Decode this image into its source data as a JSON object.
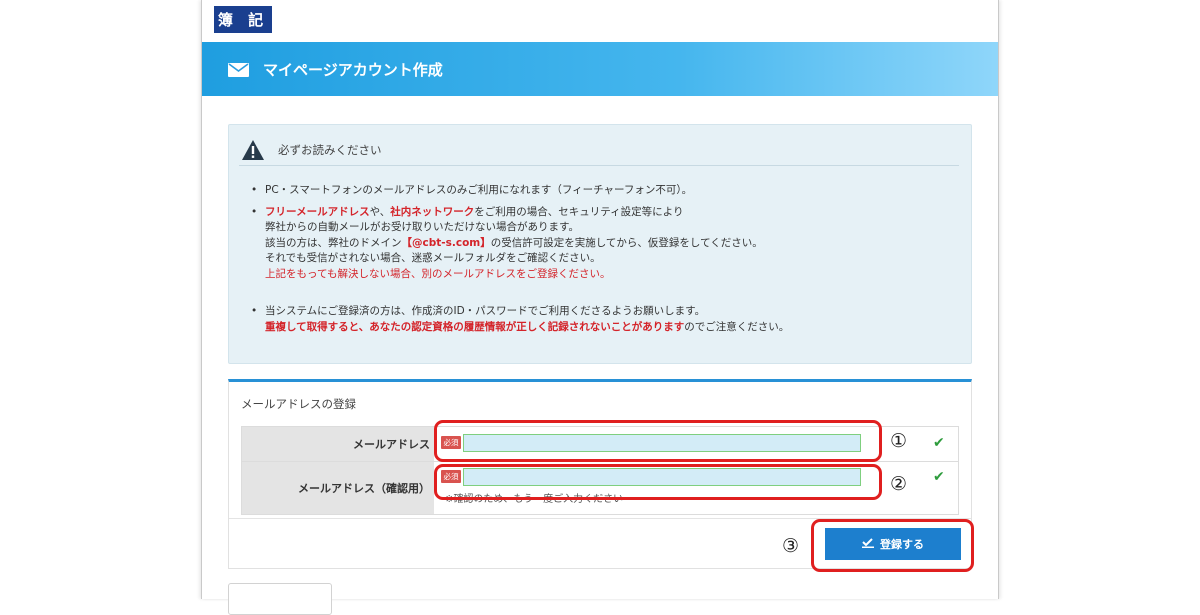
{
  "logo": {
    "text": "簿 記"
  },
  "header": {
    "icon": "mail-icon",
    "title": "マイページアカウント作成"
  },
  "notice": {
    "icon": "warning-icon",
    "heading": "必ずお読みください",
    "b1": "PC・スマートフォンのメールアドレスのみご利用になれます（フィーチャーフォン不可）。",
    "b2_red1": "フリーメールアドレス",
    "b2_mid1": "や、",
    "b2_red2": "社内ネットワーク",
    "b2_mid2": "をご利用の場合、セキュリティ設定等により",
    "b2_l2": "弊社からの自動メールがお受け取りいただけない場合があります。",
    "b2_l3a": "該当の方は、弊社のドメイン",
    "b2_l3_domain": "【@cbt-s.com】",
    "b2_l3b": "の受信許可設定を実施してから、仮登録をしてください。",
    "b2_l4": "それでも受信がされない場合、迷惑メールフォルダをご確認ください。",
    "b2_l5": "上記をもっても解決しない場合、別のメールアドレスをご登録ください。",
    "b3_l1": "当システムにご登録済の方は、作成済のID・パスワードでご利用くださるようお願いします。",
    "b3_red": "重複して取得すると、あなたの認定資格の履歴情報が正しく記録されないことがあります",
    "b3_tail": "のでご注意ください。"
  },
  "form": {
    "title": "メールアドレスの登録",
    "email_label": "メールアドレス",
    "email_confirm_label": "メールアドレス（確認用）",
    "required_badge": "必須",
    "email_value": "",
    "email_confirm_value": "",
    "confirm_hint": "※確認のため、もう一度ご入力ください",
    "valid_mark": "✔"
  },
  "annotations": {
    "n1": "①",
    "n2": "②",
    "n3": "③"
  },
  "submit_button": {
    "label": "登録する",
    "icon": "check-icon"
  },
  "colors": {
    "accent": "#2891d6",
    "header_blue": "#1f9ee0",
    "required_red": "#d9534f",
    "highlight_red": "#e01f1f",
    "valid_green": "#2e9c3d"
  }
}
